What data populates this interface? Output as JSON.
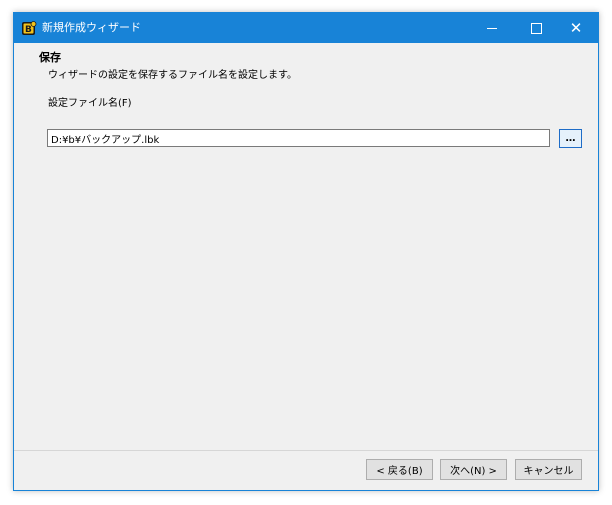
{
  "window": {
    "title": "新規作成ウィザード",
    "accent_color": "#1883d7",
    "icon": "app-icon",
    "controls": {
      "minimize_icon": "minimize-icon",
      "maximize_icon": "maximize-icon",
      "close_icon": "close-icon",
      "close_glyph": "✕"
    }
  },
  "page": {
    "heading": "保存",
    "description": "ウィザードの設定を保存するファイル名を設定します。",
    "field_label": "設定ファイル名(F)",
    "file_path": "D:¥b¥バックアップ.lbk",
    "browse_label": "…"
  },
  "footer": {
    "back_label": "< 戻る(B)",
    "next_label": "次へ(N) >",
    "cancel_label": "キャンセル"
  }
}
